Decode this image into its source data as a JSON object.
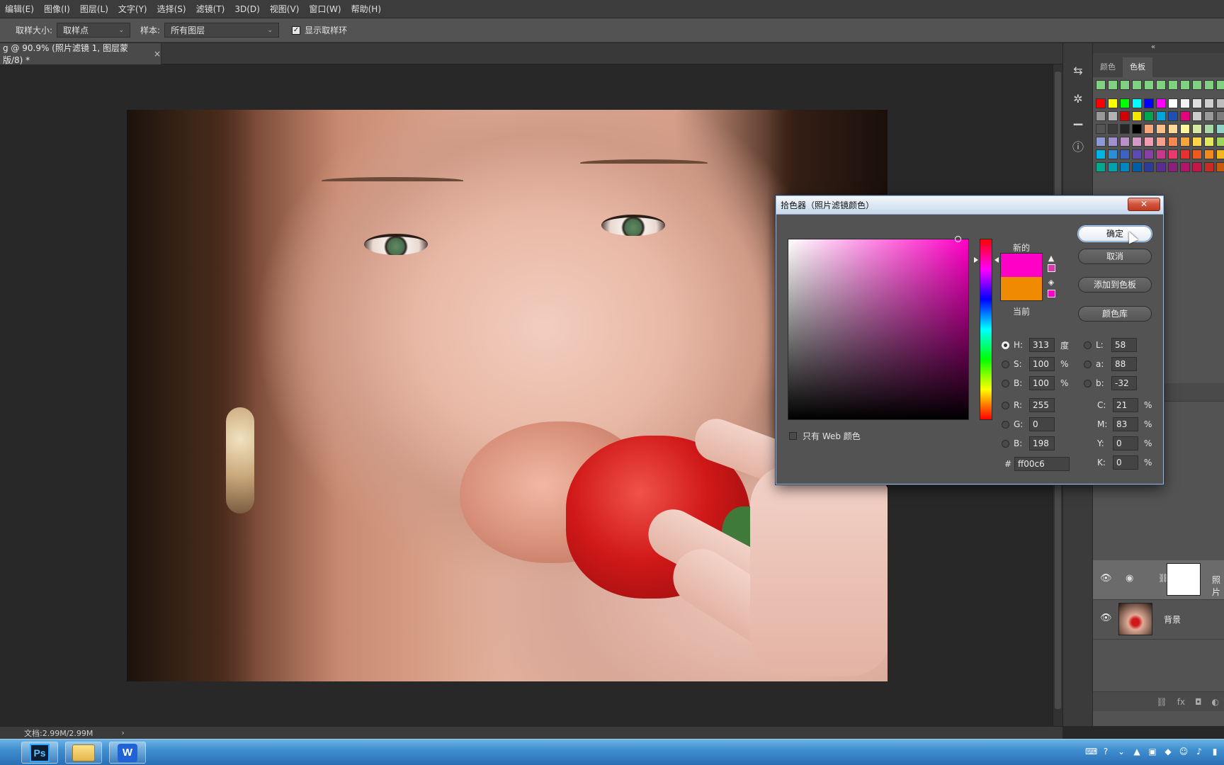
{
  "menu": [
    "编辑(E)",
    "图像(I)",
    "图层(L)",
    "文字(Y)",
    "选择(S)",
    "滤镜(T)",
    "3D(D)",
    "视图(V)",
    "窗口(W)",
    "帮助(H)"
  ],
  "options": {
    "sample_size_label": "取样大小:",
    "sample_size_value": "取样点",
    "sample_label": "样本:",
    "sample_value": "所有图层",
    "show_ring_label": "显示取样环"
  },
  "document_tab": {
    "title": "g @ 90.9% (照片滤镜 1, 图层蒙版/8) *",
    "close": "×"
  },
  "right_panel": {
    "collapse": "«",
    "tabs": [
      "颜色",
      "色板"
    ],
    "active_tab": 1
  },
  "swatch_rows": [
    [
      "#7fd07f",
      "#7fd07f",
      "#7fd07f",
      "#7fd07f",
      "#7fd07f",
      "#7fd07f",
      "#7fd07f",
      "#7fd07f",
      "#7fd07f",
      "#7fd07f",
      "#7fd07f"
    ],
    [
      "#ff0000",
      "#ffff00",
      "#00ff00",
      "#00ffff",
      "#0000ff",
      "#ff00ff",
      "#ffffff",
      "#f2f2f2",
      "#e0e0e0",
      "#cfcfcf",
      "#bdbdbd"
    ],
    [
      "#999999",
      "#b3b3b3",
      "#d40000",
      "#f5e600",
      "#00a650",
      "#00a6d6",
      "#1e50b4",
      "#e6007e",
      "#cccccc",
      "#9a9a9a",
      "#7d7d7d"
    ],
    [
      "#555555",
      "#3d3d3d",
      "#262626",
      "#000000",
      "#f7a77a",
      "#f9c08a",
      "#ffd89a",
      "#fff59d",
      "#d7e8a0",
      "#a8d8a8",
      "#8fd3c7"
    ],
    [
      "#8e9ad6",
      "#9f90d0",
      "#b790cc",
      "#d49ac6",
      "#f29bb3",
      "#f6a08f",
      "#f4884e",
      "#f7a43d",
      "#ffd34a",
      "#e6e85a",
      "#9fd45a"
    ],
    [
      "#00b4e6",
      "#2c8fd6",
      "#3a63c4",
      "#5a4cb3",
      "#8a3fa6",
      "#c53a8c",
      "#e83a6c",
      "#e8302e",
      "#ec5a20",
      "#f08a1c",
      "#f0b81c"
    ],
    [
      "#00a98f",
      "#00a2b0",
      "#0087c1",
      "#005ea8",
      "#2d3c97",
      "#5a2c8f",
      "#8a1f7e",
      "#b0156a",
      "#c81548",
      "#c82b20",
      "#c85a10"
    ]
  ],
  "layers": [
    {
      "name": "照片",
      "selected": true,
      "type": "adjustment"
    },
    {
      "name": "背景",
      "selected": false,
      "type": "image"
    }
  ],
  "status": {
    "doc": "文档:2.99M/2.99M",
    "chevron": "›"
  },
  "taskbar": {
    "apps": [
      "Ps",
      "folder",
      "W"
    ]
  },
  "picker": {
    "title": "拾色器（照片滤镜颜色）",
    "close": "✕",
    "new_label": "新的",
    "current_label": "当前",
    "new_color": "#ff00c6",
    "current_color": "#f08a00",
    "buttons": {
      "ok": "确定",
      "cancel": "取消",
      "add": "添加到色板",
      "library": "颜色库"
    },
    "fields": {
      "H": {
        "label": "H:",
        "value": "313",
        "unit": "度"
      },
      "S": {
        "label": "S:",
        "value": "100",
        "unit": "%"
      },
      "Bv": {
        "label": "B:",
        "value": "100",
        "unit": "%"
      },
      "R": {
        "label": "R:",
        "value": "255"
      },
      "G": {
        "label": "G:",
        "value": "0"
      },
      "Bl": {
        "label": "B:",
        "value": "198"
      },
      "L": {
        "label": "L:",
        "value": "58"
      },
      "a": {
        "label": "a:",
        "value": "88"
      },
      "b": {
        "label": "b:",
        "value": "-32"
      },
      "C": {
        "label": "C:",
        "value": "21",
        "unit": "%"
      },
      "M": {
        "label": "M:",
        "value": "83",
        "unit": "%"
      },
      "Y": {
        "label": "Y:",
        "value": "0",
        "unit": "%"
      },
      "K": {
        "label": "K:",
        "value": "0",
        "unit": "%"
      }
    },
    "hex_label": "#",
    "hex_value": "ff00c6",
    "web_only_label": "只有 Web 颜色"
  }
}
